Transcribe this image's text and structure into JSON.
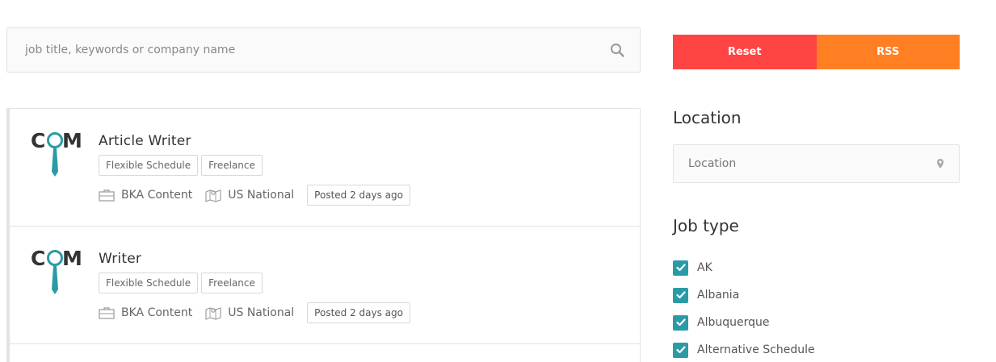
{
  "search": {
    "placeholder": "job title, keywords or company name"
  },
  "jobs": [
    {
      "title": "Article Writer",
      "tags": [
        "Flexible Schedule",
        "Freelance"
      ],
      "company": "BKA Content",
      "location": "US National",
      "posted": "Posted 2 days ago",
      "logo_text": "COM"
    },
    {
      "title": "Writer",
      "tags": [
        "Flexible Schedule",
        "Freelance"
      ],
      "company": "BKA Content",
      "location": "US National",
      "posted": "Posted 2 days ago",
      "logo_text": "COM"
    }
  ],
  "buttons": {
    "reset_label": "Reset",
    "rss_label": "RSS"
  },
  "location": {
    "heading": "Location",
    "placeholder": "Location"
  },
  "job_type": {
    "heading": "Job type",
    "options": [
      {
        "label": "AK",
        "checked": true
      },
      {
        "label": "Albania",
        "checked": true
      },
      {
        "label": "Albuquerque",
        "checked": true
      },
      {
        "label": "Alternative Schedule",
        "checked": true
      }
    ]
  },
  "colors": {
    "reset": "#ff4444",
    "rss": "#ff7f22",
    "accent": "#2a9ba6",
    "logo_dark": "#333333"
  },
  "icons": {
    "search": "search-icon",
    "company": "briefcase-icon",
    "location": "map-icon",
    "pin": "map-pin-icon",
    "check": "check-icon"
  }
}
